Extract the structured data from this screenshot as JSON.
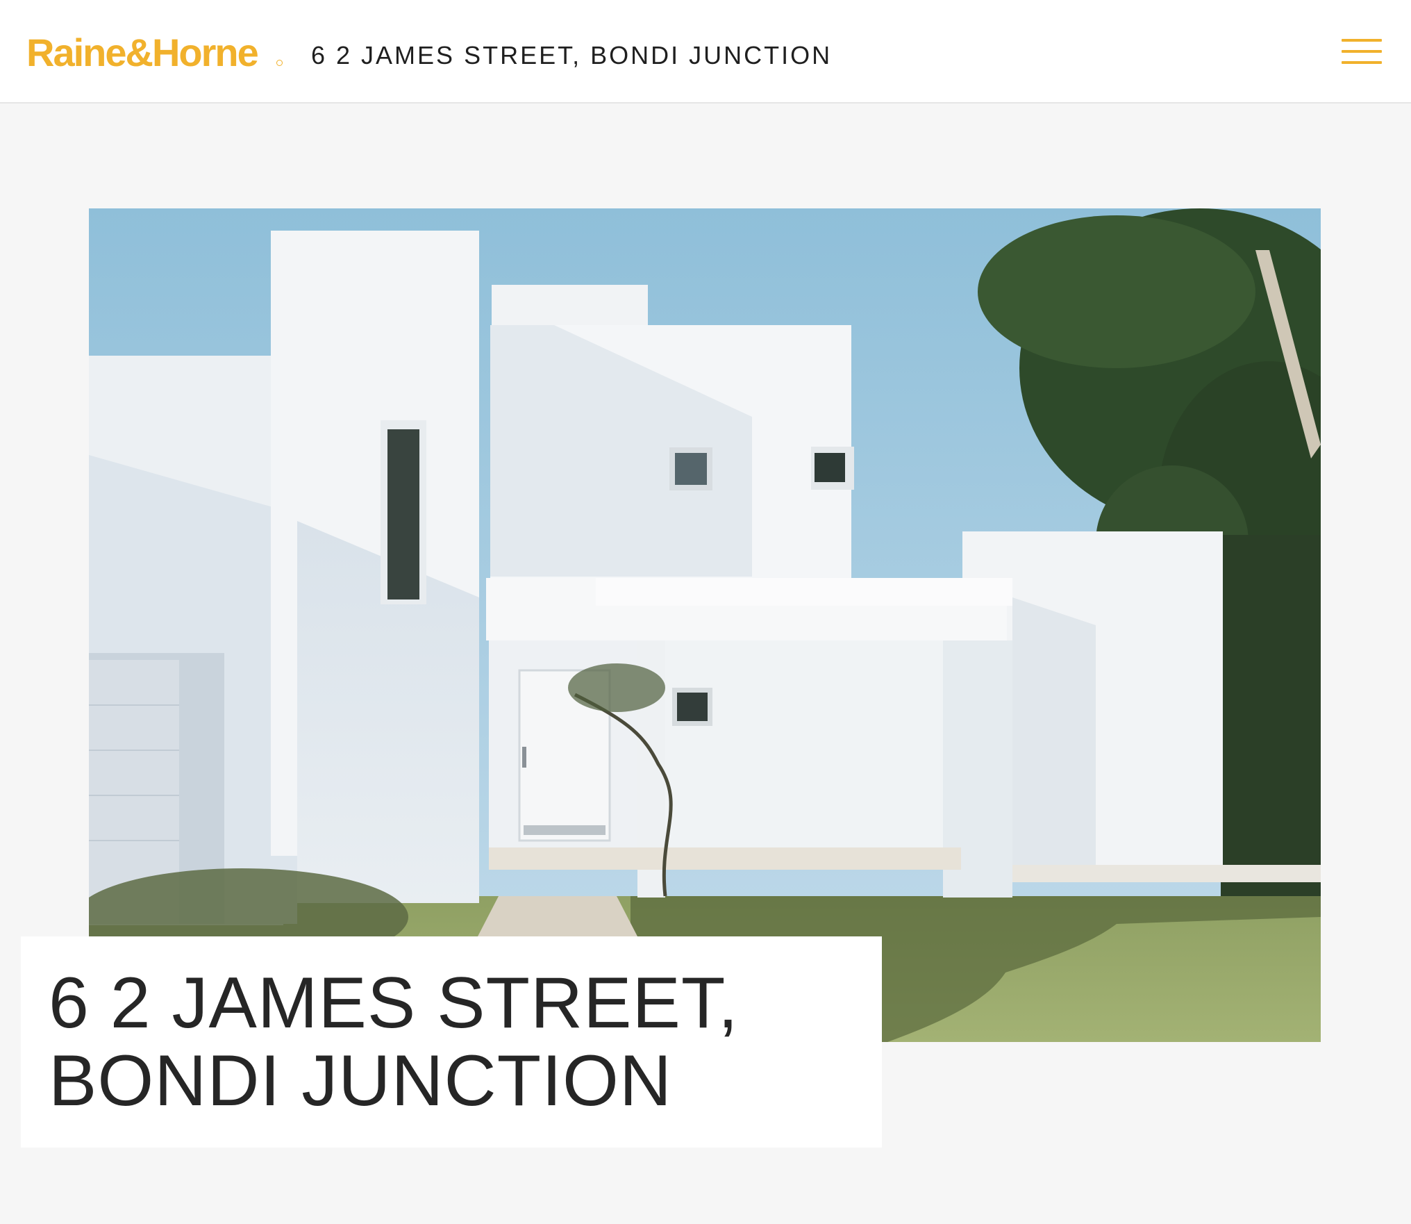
{
  "brand": {
    "name": "Raine&Horne",
    "color": "#f1b12c"
  },
  "header": {
    "title": "6 2 JAMES STREET, BONDI JUNCTION",
    "menu_icon": "hamburger-menu-icon"
  },
  "hero": {
    "image_description_icon": "property-photo"
  },
  "listing": {
    "title_line1": "6 2 JAMES STREET,",
    "title_line2": "BONDI JUNCTION"
  }
}
